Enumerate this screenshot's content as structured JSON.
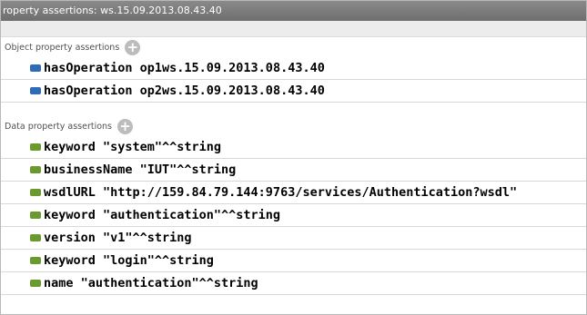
{
  "title": "roperty assertions: ws.15.09.2013.08.43.40",
  "colors": {
    "titlebar": "#7b7b7b",
    "object_badge": "#2e6cb8",
    "data_badge": "#6a9a2d"
  },
  "object_section": {
    "label": "Object property assertions",
    "add_icon": "plus-circle-icon",
    "items": [
      {
        "property": "hasOperation",
        "value": "op1ws.15.09.2013.08.43.40"
      },
      {
        "property": "hasOperation",
        "value": "op2ws.15.09.2013.08.43.40"
      }
    ]
  },
  "data_section": {
    "label": "Data property assertions",
    "add_icon": "plus-circle-icon",
    "items": [
      {
        "property": "keyword",
        "value": "\"system\"^^string"
      },
      {
        "property": "businessName",
        "value": "\"IUT\"^^string"
      },
      {
        "property": "wsdlURL",
        "value": "\"http://159.84.79.144:9763/services/Authentication?wsdl\""
      },
      {
        "property": "keyword",
        "value": "\"authentication\"^^string"
      },
      {
        "property": "version",
        "value": "\"v1\"^^string"
      },
      {
        "property": "keyword",
        "value": "\"login\"^^string"
      },
      {
        "property": "name",
        "value": "\"authentication\"^^string"
      }
    ]
  }
}
